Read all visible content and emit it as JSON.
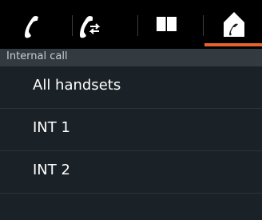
{
  "tabs": [
    {
      "icon": "phone-handset-icon"
    },
    {
      "icon": "call-transfer-icon"
    },
    {
      "icon": "phonebook-icon"
    },
    {
      "icon": "internal-call-icon",
      "active": true
    }
  ],
  "accent_color": "#e8632b",
  "header": {
    "title": "Internal call"
  },
  "list": {
    "items": [
      {
        "label": "All handsets"
      },
      {
        "label": "INT 1"
      },
      {
        "label": "INT 2"
      },
      {
        "label": ""
      }
    ]
  }
}
